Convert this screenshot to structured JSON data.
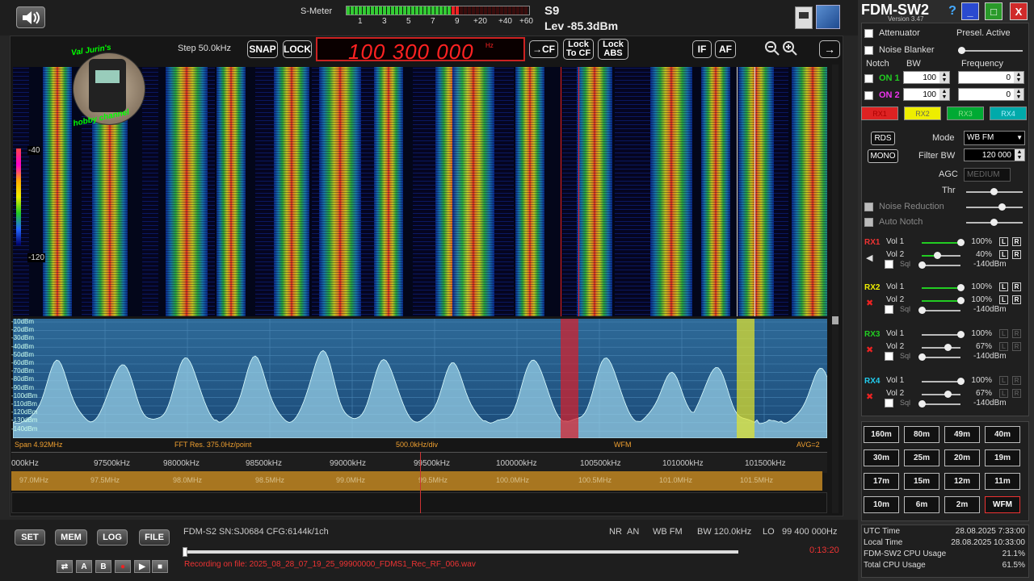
{
  "app": {
    "title": "FDM-SW2",
    "version": "Version 3.47"
  },
  "smeter": {
    "label": "S-Meter",
    "scale": [
      "1",
      "3",
      "5",
      "7",
      "9",
      "+20",
      "+40",
      "+60"
    ],
    "level_fraction": 0.62,
    "s_value": "S9",
    "level": "Lev -85.3dBm"
  },
  "toolbar": {
    "step": "Step 50.0kHz",
    "snap": "SNAP",
    "lock": "LOCK",
    "frequency": "100 300 000",
    "freq_unit": "Hz",
    "to_cf": "→CF",
    "lock_to_cf_1": "Lock",
    "lock_to_cf_2": "To CF",
    "lock_abs_1": "Lock",
    "lock_abs_2": "ABS",
    "if": "IF",
    "af": "AF"
  },
  "logo": {
    "text1": "Val Jurin's",
    "text2": "hobby channel"
  },
  "waterfall": {
    "scale_top": "-40",
    "scale_bottom": "-120"
  },
  "spectrum": {
    "db_labels": [
      "-10dBm",
      "-20dBm",
      "-30dBm",
      "-40dBm",
      "-50dBm",
      "-60dBm",
      "-70dBm",
      "-80dBm",
      "-90dBm",
      "-100dBm",
      "-110dBm",
      "-120dBm",
      "-130dBm",
      "-140dBm"
    ],
    "span": "Span 4.92MHz",
    "fft_res": "FFT Res. 375.0Hz/point",
    "div": "500.0kHz/div",
    "mode": "WFM",
    "avg": "AVG=2"
  },
  "freq_axis": [
    "000kHz",
    "97500kHz",
    "98000kHz",
    "98500kHz",
    "99000kHz",
    "99500kHz",
    "100000kHz",
    "100500kHz",
    "101000kHz",
    "101500kHz"
  ],
  "band_axis": [
    "97.0MHz",
    "97.5MHz",
    "98.0MHz",
    "98.5MHz",
    "99.0MHz",
    "99.5MHz",
    "100.0MHz",
    "100.5MHz",
    "101.0MHz",
    "101.5MHz"
  ],
  "bottom": {
    "set": "SET",
    "mem": "MEM",
    "log": "LOG",
    "file": "FILE",
    "device": "FDM-S2 SN:SJ0684  CFG:6144k/1ch",
    "nr": "NR",
    "an": "AN",
    "mode": "WB FM",
    "bw": "BW 120.0kHz",
    "lo_label": "LO",
    "lo": "99 400 000Hz",
    "time": "0:13:20",
    "recording": "Recording on file: 2025_08_28_07_19_25_99900000_FDMS1_Rec_RF_006.wav",
    "transport": [
      "⇄",
      "A",
      "B",
      "●",
      "▶",
      "■"
    ]
  },
  "panel": {
    "attenuator": "Attenuator",
    "presel": "Presel. Active",
    "noise_blanker": "Noise Blanker",
    "notch": "Notch",
    "bw": "BW",
    "frequency": "Frequency",
    "on1": "ON 1",
    "on2": "ON 2",
    "notch1_bw": "100",
    "notch2_bw": "100",
    "notch1_freq": "0",
    "notch2_freq": "0",
    "rx_tabs": [
      "RX1",
      "RX2",
      "RX3",
      "RX4"
    ],
    "rds": "RDS",
    "mono": "MONO",
    "mode_label": "Mode",
    "mode_value": "WB FM",
    "filter_bw_label": "Filter BW",
    "filter_bw_value": "120 000",
    "agc_label": "AGC",
    "agc_value": "MEDIUM",
    "thr_label": "Thr",
    "noise_reduction": "Noise Reduction",
    "auto_notch": "Auto Notch",
    "receivers": [
      {
        "name": "RX1",
        "color": "#e33",
        "vol1": "100%",
        "vol2": "40%",
        "sql": "-140dBm",
        "vol1_level": 1.0,
        "vol2_level": 0.4,
        "muted": false
      },
      {
        "name": "RX2",
        "color": "#ee0",
        "vol1": "100%",
        "vol2": "100%",
        "sql": "-140dBm",
        "vol1_level": 1.0,
        "vol2_level": 1.0,
        "muted": true
      },
      {
        "name": "RX3",
        "color": "#2c2",
        "vol1": "100%",
        "vol2": "67%",
        "sql": "-140dBm",
        "vol1_level": 1.0,
        "vol2_level": 0.67,
        "muted": true
      },
      {
        "name": "RX4",
        "color": "#2ce",
        "vol1": "100%",
        "vol2": "67%",
        "sql": "-140dBm",
        "vol1_level": 1.0,
        "vol2_level": 0.67,
        "muted": true
      }
    ],
    "vol1_label": "Vol 1",
    "vol2_label": "Vol 2",
    "sql_label": "Sql"
  },
  "bands": [
    "160m",
    "80m",
    "49m",
    "40m",
    "30m",
    "25m",
    "20m",
    "19m",
    "17m",
    "15m",
    "12m",
    "11m",
    "10m",
    "6m",
    "2m",
    "WFM"
  ],
  "status": {
    "utc_label": "UTC Time",
    "utc": "28.08.2025 7:33:00",
    "local_label": "Local Time",
    "local": "28.08.2025 10:33:00",
    "cpu_label": "FDM-SW2 CPU Usage",
    "cpu": "21.1%",
    "total_label": "Total CPU Usage",
    "total": "61.5%"
  }
}
